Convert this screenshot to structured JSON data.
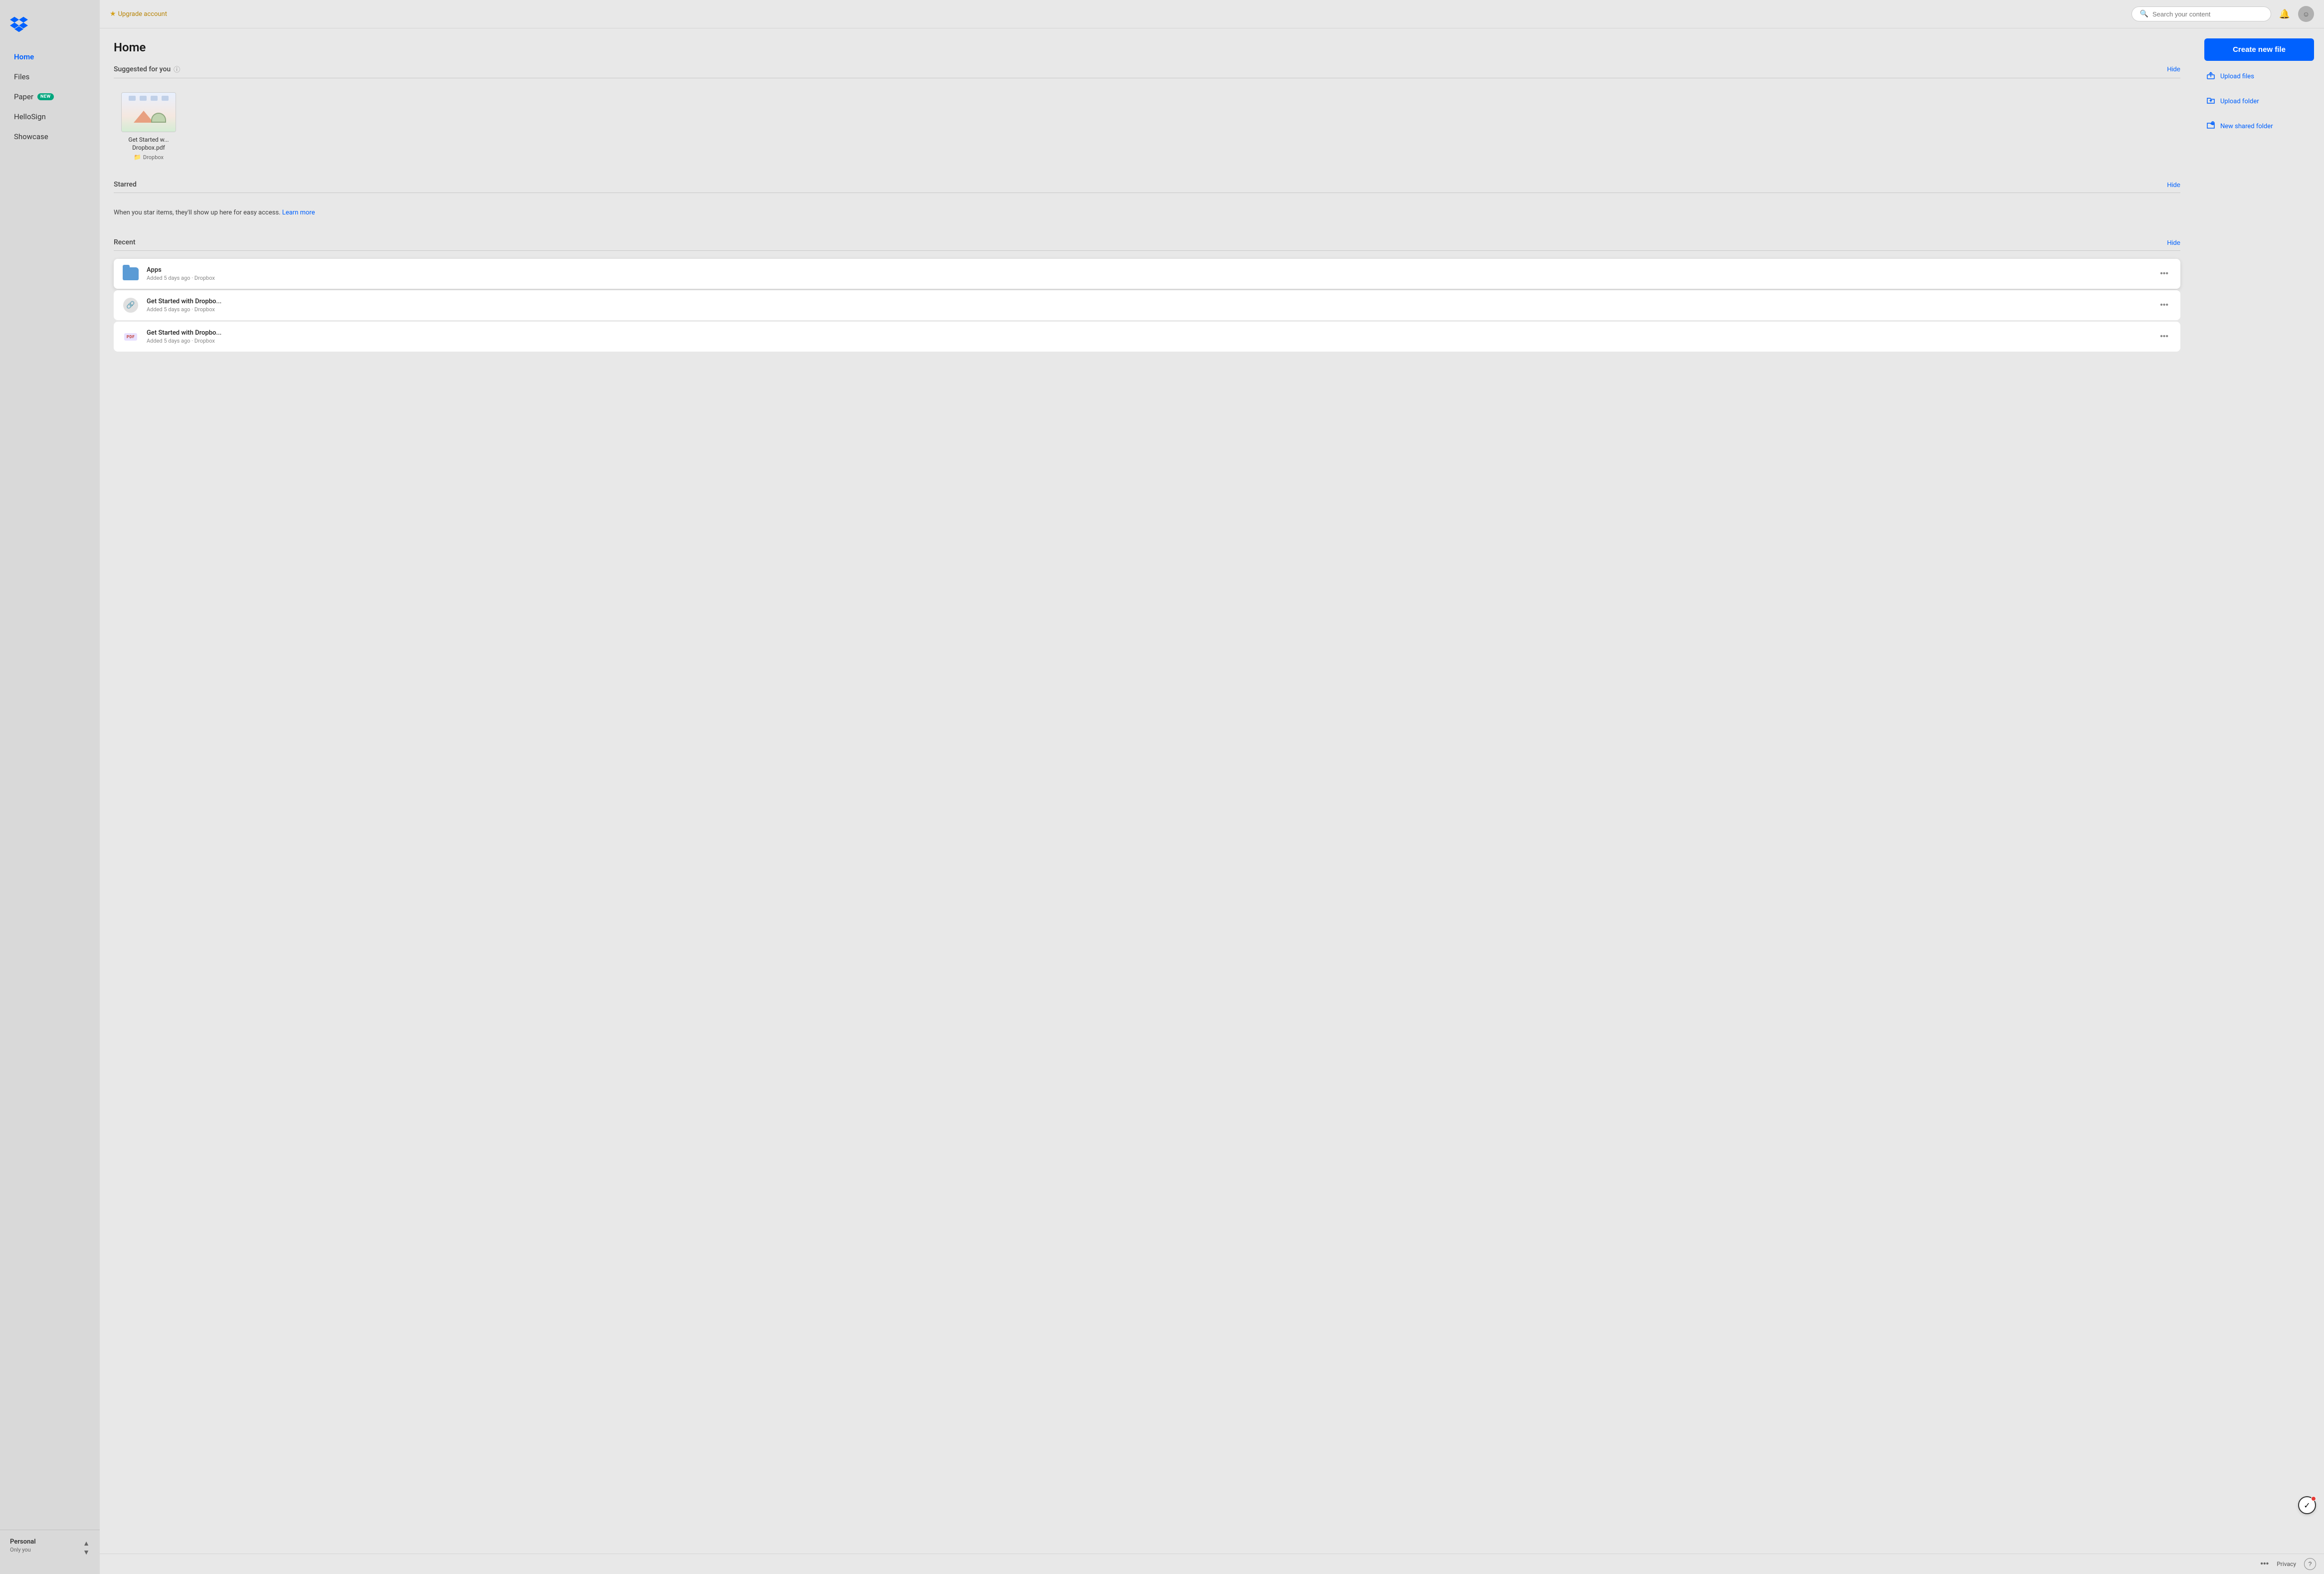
{
  "header": {
    "upgrade_label": "Upgrade account",
    "search_placeholder": "Search your content"
  },
  "sidebar": {
    "items": [
      {
        "id": "home",
        "label": "Home",
        "active": true
      },
      {
        "id": "files",
        "label": "Files",
        "active": false
      },
      {
        "id": "paper",
        "label": "Paper",
        "active": false,
        "badge": "New"
      },
      {
        "id": "hellosign",
        "label": "HelloSign",
        "active": false
      },
      {
        "id": "showcase",
        "label": "Showcase",
        "active": false
      }
    ],
    "footer": {
      "title": "Personal",
      "subtitle": "Only you"
    }
  },
  "page": {
    "title": "Home",
    "suggested": {
      "section_label": "Suggested for you",
      "hide_label": "Hide",
      "file": {
        "name": "Get Started w... Dropbox.pdf",
        "location": "Dropbox"
      }
    },
    "starred": {
      "section_label": "Starred",
      "hide_label": "Hide",
      "empty_text": "When you star items, they'll show up here for easy access.",
      "learn_more_label": "Learn more"
    },
    "recent": {
      "section_label": "Recent",
      "hide_label": "Hide",
      "items": [
        {
          "id": "apps",
          "name": "Apps",
          "meta": "Added 5 days ago · Dropbox",
          "type": "folder"
        },
        {
          "id": "link1",
          "name": "Get Started with Dropbo...",
          "meta": "Added 5 days ago · Dropbox",
          "type": "link"
        },
        {
          "id": "pdf1",
          "name": "Get Started with Dropbo...",
          "meta": "Added 5 days ago · Dropbox",
          "type": "pdf"
        }
      ]
    }
  },
  "right_panel": {
    "create_label": "Create new file",
    "actions": [
      {
        "id": "upload-files",
        "label": "Upload files",
        "icon": "upload-file"
      },
      {
        "id": "upload-folder",
        "label": "Upload folder",
        "icon": "upload-folder"
      },
      {
        "id": "new-shared-folder",
        "label": "New shared folder",
        "icon": "shared-folder"
      }
    ]
  },
  "bottom": {
    "privacy_label": "Privacy",
    "help_label": "?"
  }
}
